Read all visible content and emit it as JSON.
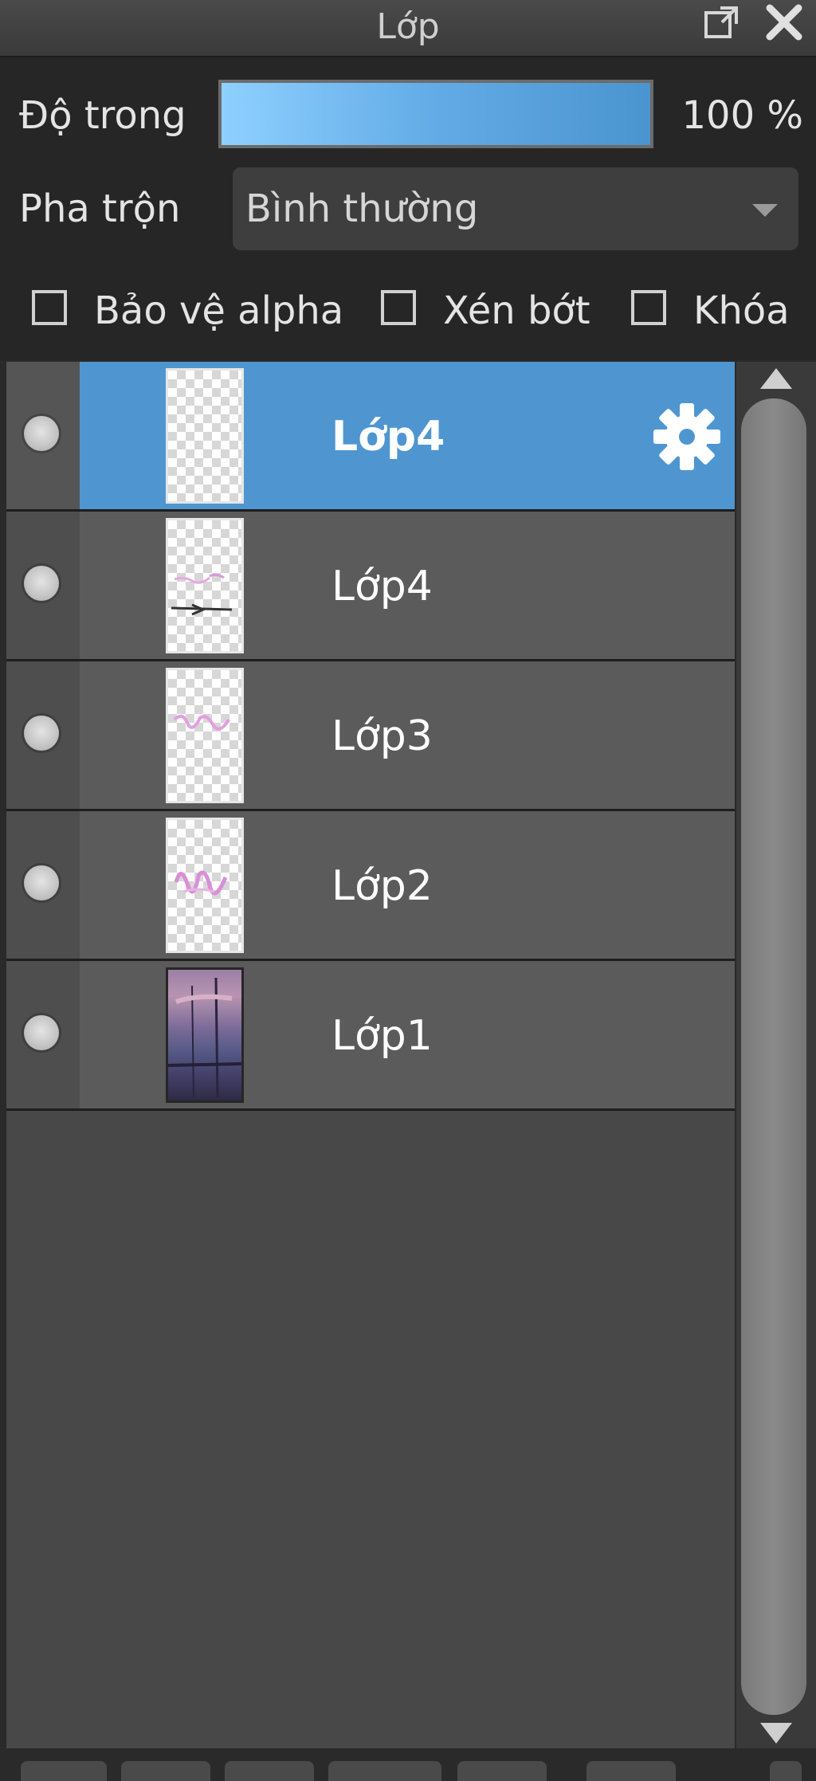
{
  "window": {
    "title": "Lớp",
    "popout_icon": "popout-icon",
    "close_icon": "close-icon"
  },
  "controls": {
    "opacity": {
      "label": "Độ trong",
      "value_text": "100 %",
      "value_fraction": 1.0
    },
    "blend": {
      "label": "Pha trộn",
      "value": "Bình thường"
    },
    "checkboxes": [
      {
        "label": "Bảo vệ alpha",
        "checked": false
      },
      {
        "label": "Xén bớt",
        "checked": false
      },
      {
        "label": "Khóa",
        "checked": false
      }
    ]
  },
  "layers": [
    {
      "name": "Lớp4",
      "selected": true,
      "visible": true,
      "thumbnail": "transparent-empty"
    },
    {
      "name": "Lớp4",
      "selected": false,
      "visible": true,
      "thumbnail": "transparent-sketch"
    },
    {
      "name": "Lớp3",
      "selected": false,
      "visible": true,
      "thumbnail": "transparent-pink-strokes"
    },
    {
      "name": "Lớp2",
      "selected": false,
      "visible": true,
      "thumbnail": "transparent-pink-strokes"
    },
    {
      "name": "Lớp1",
      "selected": false,
      "visible": true,
      "thumbnail": "photo-background"
    }
  ],
  "colors": {
    "selection": "#4f96d1",
    "row": "#5b5b5b",
    "panel": "#2a2a2a"
  }
}
